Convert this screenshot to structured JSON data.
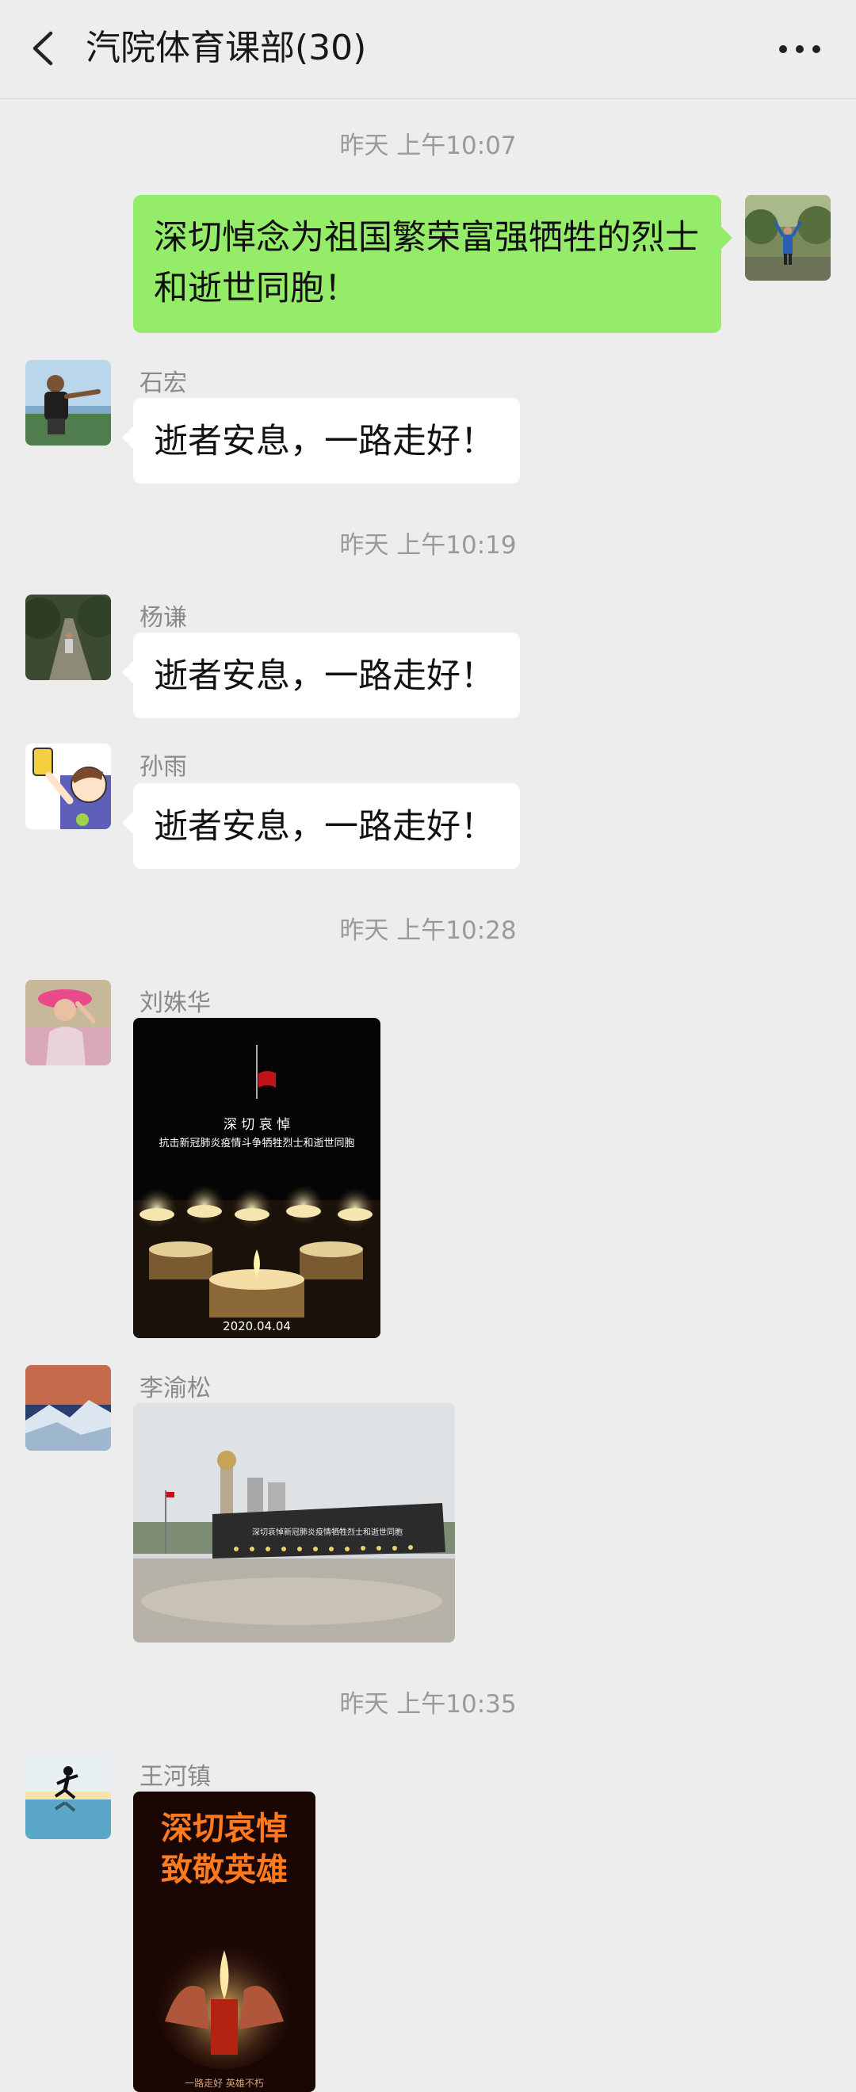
{
  "header": {
    "title": "汽院体育课部(30)"
  },
  "timestamps": [
    "昨天 上午10:07",
    "昨天 上午10:19",
    "昨天 上午10:28",
    "昨天 上午10:35"
  ],
  "messages": [
    {
      "sender": "",
      "text": "深切悼念为祖国繁荣富强牺牲的烈士和逝世同胞！",
      "own": true
    },
    {
      "sender": "石宏",
      "text": "逝者安息，一路走好！"
    },
    {
      "sender": "杨谦",
      "text": "逝者安息，一路走好！"
    },
    {
      "sender": "孙雨",
      "text": "逝者安息，一路走好！"
    },
    {
      "sender": "刘姝华",
      "image": {
        "heading": "深 切 哀 悼",
        "caption": "抗击新冠肺炎疫情斗争牺牲烈士和逝世同胞",
        "date": "2020.04.04"
      }
    },
    {
      "sender": "李渝松",
      "image": {
        "banner": "深切哀悼新冠肺炎疫情牺牲烈士和逝世同胞"
      }
    },
    {
      "sender": "王河镇",
      "image": {
        "line1": "深切哀悼",
        "line2": "致敬英雄",
        "footer": "一路走好 英雄不朽"
      }
    }
  ],
  "colors": {
    "background": "#ededed",
    "own_bubble": "#95ec69",
    "bubble": "#ffffff",
    "meta_text": "#9a9a9a"
  },
  "icons": [
    "back-arrow-icon",
    "more-dots-icon"
  ]
}
